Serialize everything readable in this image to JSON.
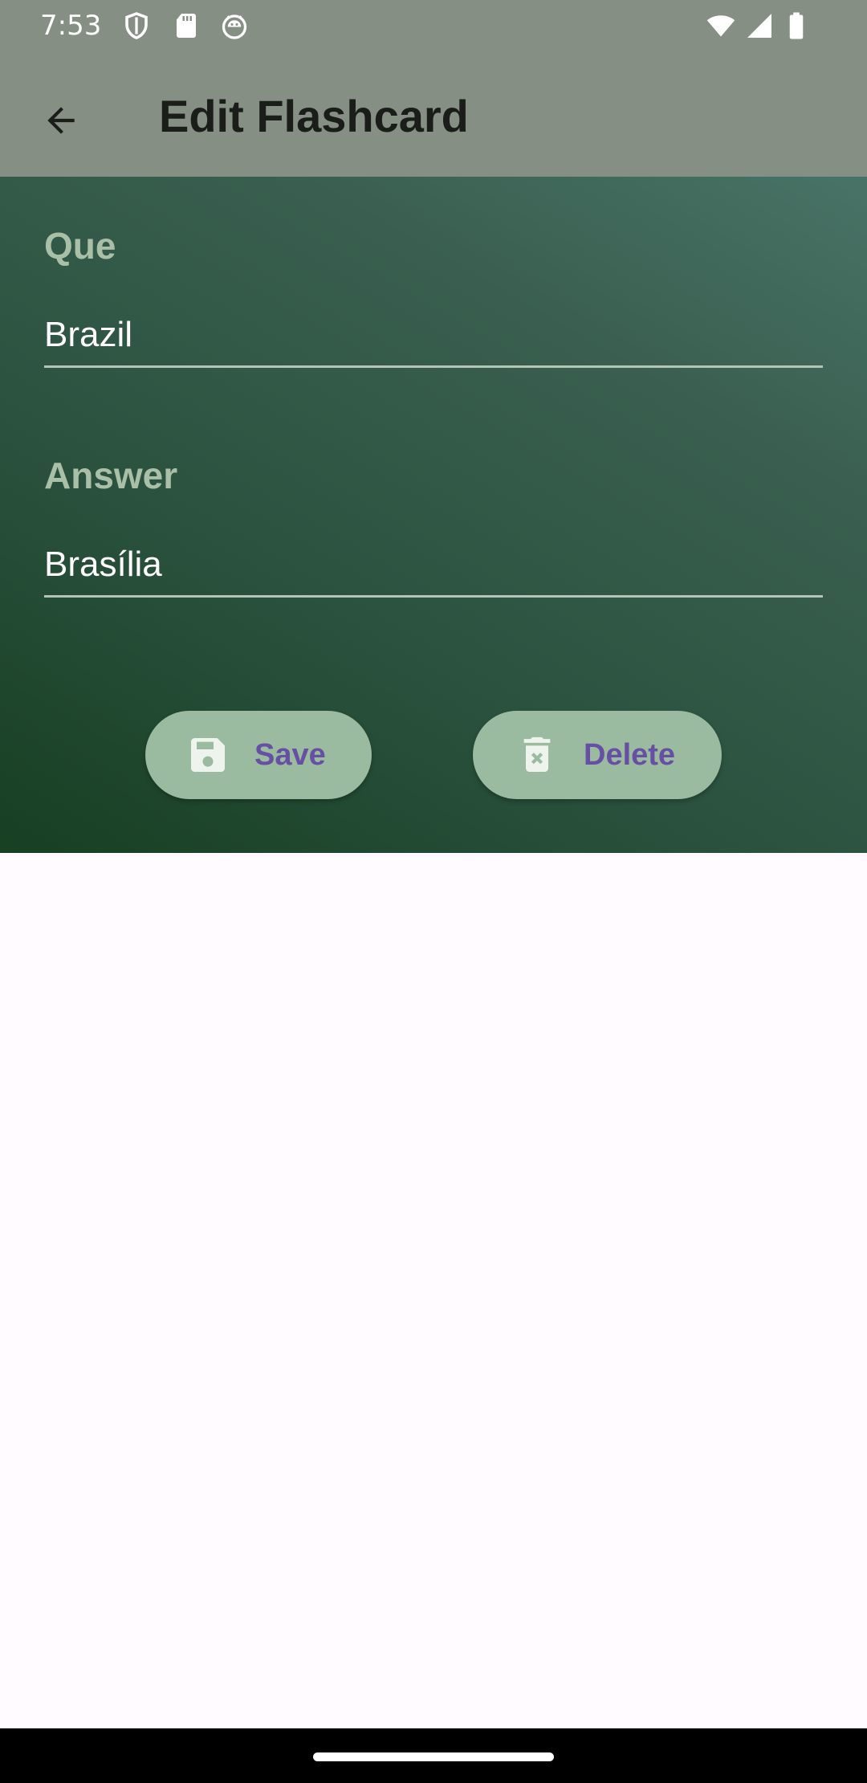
{
  "status_bar": {
    "time": "7:53",
    "icons": [
      "shield-icon",
      "sd-card-icon",
      "android-debug-icon",
      "wifi-icon",
      "cellular-signal-icon",
      "battery-icon"
    ]
  },
  "app_bar": {
    "title": "Edit Flashcard",
    "back_icon": "arrow-back-icon"
  },
  "form": {
    "question_label": "Que",
    "question_value": "Brazil",
    "answer_label": "Answer",
    "answer_value": "Brasília"
  },
  "actions": {
    "save_label": "Save",
    "save_icon": "floppy-disk-icon",
    "delete_label": "Delete",
    "delete_icon": "delete-forever-icon"
  },
  "colors": {
    "app_bar": "#868f83",
    "form_gradient_dark": "#173f22",
    "form_gradient_light": "#487366",
    "button_bg": "#9bbba0",
    "button_text": "#6750a4",
    "field_label": "#a9bfa8",
    "page_bg": "#fffbfe"
  }
}
